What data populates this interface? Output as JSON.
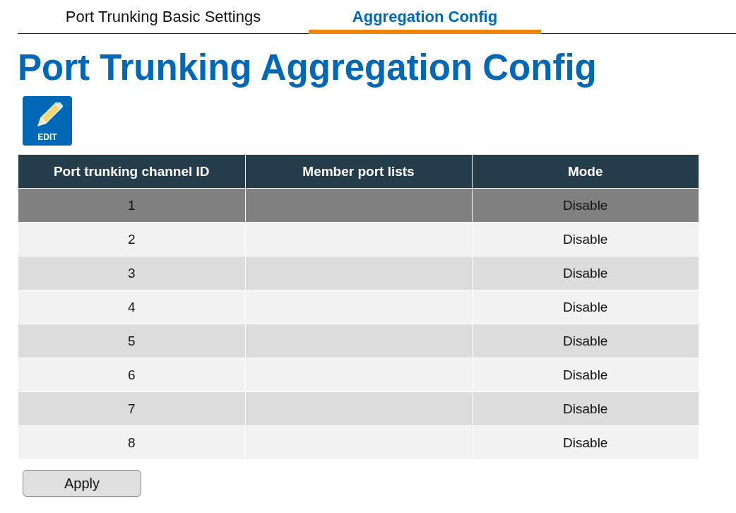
{
  "tabs": [
    {
      "label": "Port Trunking Basic Settings",
      "selected": false
    },
    {
      "label": "Aggregation Config",
      "selected": true
    }
  ],
  "title": "Port Trunking Aggregation Config",
  "edit_button": {
    "label": "EDIT"
  },
  "table": {
    "columns": [
      "Port trunking channel ID",
      "Member port lists",
      "Mode"
    ],
    "rows": [
      {
        "cells": [
          "1",
          "",
          "Disable"
        ],
        "selected": true
      },
      {
        "cells": [
          "2",
          "",
          "Disable"
        ],
        "selected": false
      },
      {
        "cells": [
          "3",
          "",
          "Disable"
        ],
        "selected": false
      },
      {
        "cells": [
          "4",
          "",
          "Disable"
        ],
        "selected": false
      },
      {
        "cells": [
          "5",
          "",
          "Disable"
        ],
        "selected": false
      },
      {
        "cells": [
          "6",
          "",
          "Disable"
        ],
        "selected": false
      },
      {
        "cells": [
          "7",
          "",
          "Disable"
        ],
        "selected": false
      },
      {
        "cells": [
          "8",
          "",
          "Disable"
        ],
        "selected": false
      }
    ]
  },
  "apply_button": "Apply"
}
